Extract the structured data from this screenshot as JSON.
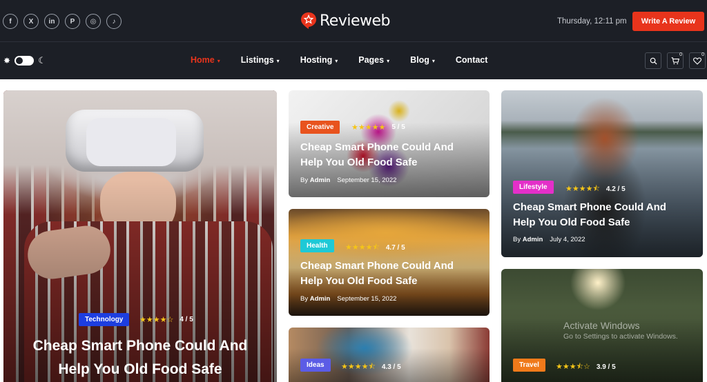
{
  "header": {
    "socials": [
      {
        "icon": "facebook-icon",
        "glyph": "f"
      },
      {
        "icon": "x-twitter-icon",
        "glyph": "X"
      },
      {
        "icon": "linkedin-icon",
        "glyph": "in"
      },
      {
        "icon": "pinterest-icon",
        "glyph": "P"
      },
      {
        "icon": "instagram-icon",
        "glyph": "◎"
      },
      {
        "icon": "tiktok-icon",
        "glyph": "♪"
      }
    ],
    "logo_text": "Revieweb",
    "datetime": "Thursday, 12:11 pm",
    "write_review_label": "Write A Review",
    "accent": "#e8341c"
  },
  "nav": {
    "items": [
      {
        "label": "Home",
        "active": true,
        "dropdown": true
      },
      {
        "label": "Listings",
        "active": false,
        "dropdown": true
      },
      {
        "label": "Hosting",
        "active": false,
        "dropdown": true
      },
      {
        "label": "Pages",
        "active": false,
        "dropdown": true
      },
      {
        "label": "Blog",
        "active": false,
        "dropdown": true
      },
      {
        "label": "Contact",
        "active": false,
        "dropdown": false
      }
    ],
    "cart_count": "0",
    "wishlist_count": "0"
  },
  "cards": {
    "featured": {
      "tag": "Technology",
      "tag_color": "#1d3ee0",
      "stars": 4,
      "rating": "4 / 5",
      "title_line1": "Cheap Smart Phone Could And",
      "title_line2": "Help You Old Food Safe"
    },
    "creative": {
      "tag": "Creative",
      "tag_color": "#e8531e",
      "stars": 5,
      "rating": "5 / 5",
      "title_line1": "Cheap Smart Phone Could And",
      "title_line2": "Help You Old Food Safe",
      "by": "By",
      "author": "Admin",
      "date": "September 15, 2022"
    },
    "health": {
      "tag": "Health",
      "tag_color": "#1ec9d6",
      "stars": 4.7,
      "rating": "4.7 / 5",
      "title_line1": "Cheap Smart Phone Could And",
      "title_line2": "Help You Old Food Safe",
      "by": "By",
      "author": "Admin",
      "date": "September 15, 2022"
    },
    "ideas": {
      "tag": "Ideas",
      "tag_color": "#5b5ce6",
      "stars": 4.3,
      "rating": "4.3 / 5"
    },
    "lifestyle": {
      "tag": "Lifestyle",
      "tag_color": "#e42fc9",
      "stars": 4.2,
      "rating": "4.2 / 5",
      "title_line1": "Cheap Smart Phone Could And",
      "title_line2": "Help You Old Food Safe",
      "by": "By",
      "author": "Admin",
      "date": "July 4, 2022"
    },
    "travel": {
      "tag": "Travel",
      "tag_color": "#f07a1a",
      "stars": 3.9,
      "rating": "3.9 / 5"
    }
  },
  "watermark": {
    "line1": "Activate Windows",
    "line2": "Go to Settings to activate Windows."
  }
}
